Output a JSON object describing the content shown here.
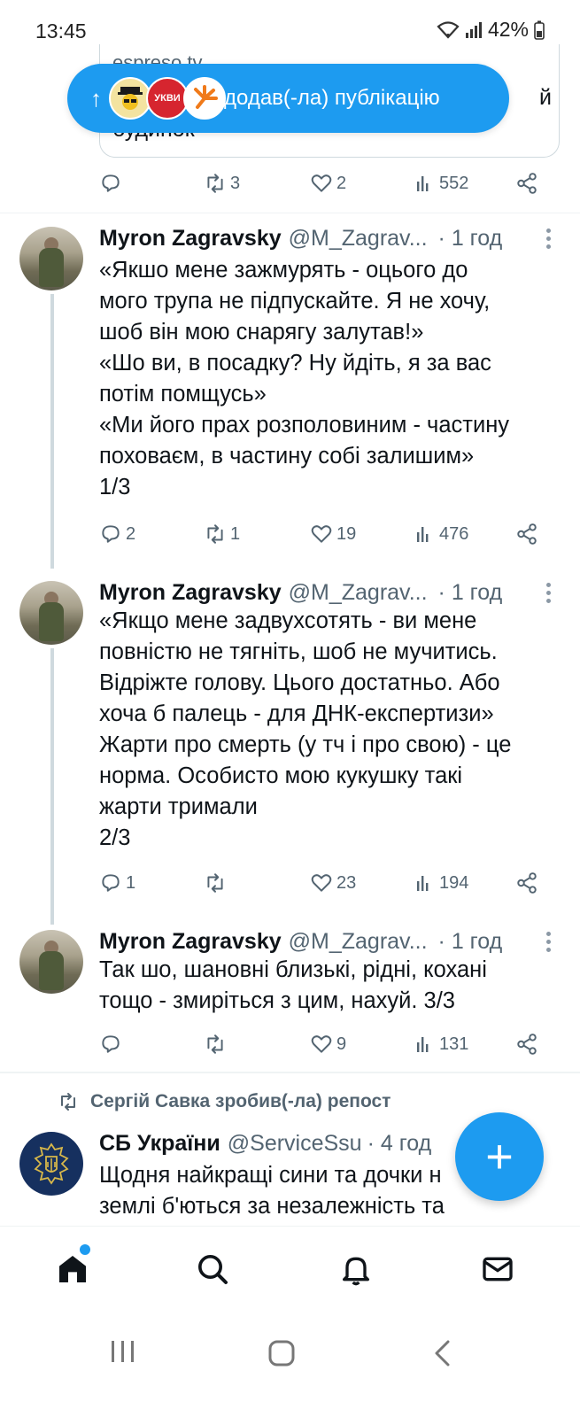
{
  "status_bar": {
    "time": "13:45",
    "battery": "42%"
  },
  "prev_tweet": {
    "card_line1": "espreso.tv",
    "card_line2": "будинок",
    "card_right": "й",
    "reply_count": "",
    "retweet_count": "3",
    "like_count": "2",
    "view_count": "552"
  },
  "new_posts_pill": {
    "arrow": "↑",
    "avatar2_label": "УКВИ",
    "text": "додав(-ла) публікацію"
  },
  "tweets": [
    {
      "name": "Myron Zagravsky",
      "handle": "@M_Zagrav...",
      "time": "· 1 год",
      "lines": [
        "«Якшо мене зажмурять - оцього до",
        "мого трупа не підпускайте. Я не хочу,",
        "шоб він мою снарягу залутав!»",
        "«Шо ви, в посадку? Ну йдіть, я за вас",
        "потім помщусь»",
        "«Ми його прах розполовиним - частину",
        "поховаєм, в частину собі залишим»",
        "1/3"
      ],
      "reply_count": "2",
      "retweet_count": "1",
      "like_count": "19",
      "view_count": "476"
    },
    {
      "name": "Myron Zagravsky",
      "handle": "@M_Zagrav...",
      "time": "· 1 год",
      "lines": [
        "«Якщо мене задвухсотять - ви мене",
        "повністю не тягніть, шоб не мучитись.",
        "Відріжте голову. Цього достатньо. Або",
        "хоча б палець - для ДНК-експертизи»",
        "Жарти про смерть (у тч і про свою) - це",
        "норма. Особисто мою кукушку такі",
        "жарти тримали",
        "2/3"
      ],
      "reply_count": "1",
      "retweet_count": "",
      "like_count": "23",
      "view_count": "194"
    },
    {
      "name": "Myron Zagravsky",
      "handle": "@M_Zagrav...",
      "time": "· 1 год",
      "lines": [
        "Так шо, шановні близькі, рідні, кохані",
        "тощо - змиріться з цим, нахуй. 3/3"
      ],
      "reply_count": "",
      "retweet_count": "",
      "like_count": "9",
      "view_count": "131"
    }
  ],
  "repost": {
    "text": "Сергій Савка зробив(-ла) репост"
  },
  "sbu_tweet": {
    "name": "СБ України",
    "handle": "@ServiceSsu",
    "time": "· 4 год",
    "lines": [
      "Щодня найкращі сини та дочки н",
      "землі б'ються за незалежність та"
    ]
  },
  "fab": {
    "label": "+"
  },
  "colors": {
    "accent": "#1d9bf0",
    "text": "#0f1419",
    "secondary": "#536471"
  }
}
